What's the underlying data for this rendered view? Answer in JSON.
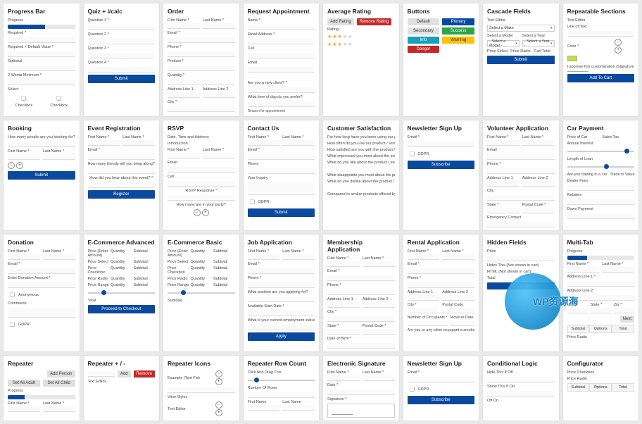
{
  "cards": {
    "progress_bar": {
      "title": "Progress Bar",
      "fields": [
        "Progress",
        "Required *",
        "Required + Default Value *",
        "Optional",
        "2 Words Minimum *",
        "Select"
      ],
      "checkbox_a": "Checkbox",
      "checkbox_b": "Checkbox",
      "progress_pct": 55
    },
    "quiz": {
      "title": "Quiz + #calc",
      "fields": [
        "Question 1 *",
        "Question 2 *",
        "Question 3 *",
        "Question 4 *"
      ],
      "submit": "Submit"
    },
    "order": {
      "title": "Order",
      "first": "First Name *",
      "last": "Last Name *",
      "email": "Email *",
      "phone": "Phone *",
      "product": "Product *",
      "qty": "Quantity *",
      "addr1": "Address Line 1",
      "addr2": "Address Line 2",
      "city": "City *"
    },
    "request_appt": {
      "title": "Request Appointment",
      "name": "Name *",
      "email": "Email Address *",
      "cell": "Cell",
      "email2": "Email",
      "new_client": "Are you a new client? *",
      "time_q": "What time of day do you prefer?",
      "reason": "Reason for appointment"
    },
    "avg_rating": {
      "title": "Average Rating",
      "add": "Add Rating",
      "remove": "Remove Rating",
      "rating_lbl": "Rating",
      "stars": 3
    },
    "buttons": {
      "title": "Buttons",
      "labels": {
        "default": "Default",
        "primary": "Primary",
        "secondary": "Secondary",
        "success": "Success",
        "info": "Info",
        "warning": "Warning",
        "danger": "Danger"
      }
    },
    "cascade": {
      "title": "Cascade Fields",
      "text_editor": "Text Editor",
      "select_make": "Select a Make",
      "select_model": "Select a Model",
      "select_year": "Select a Year",
      "select_model2": "- Select a Model -",
      "select_year2": "- Select a Year -",
      "price_select": "Price Select",
      "price_radio": "Price Radio",
      "cart_total": "Cart Total",
      "submit": "Submit"
    },
    "repeatable": {
      "title": "Repeatable Sections",
      "text_editor": "Text Editor",
      "line_of_text": "Line of Text",
      "color": "Color *",
      "approve": "I approve this customization (Signature) *",
      "add_cart": "Add To Cart"
    },
    "booking": {
      "title": "Booking",
      "q1": "How many people are you booking for?",
      "first": "First Name *",
      "last": "Last Name *",
      "submit": "Submit"
    },
    "event_reg": {
      "title": "Event Registration",
      "first": "First Name *",
      "last": "Last Name *",
      "email": "Email *",
      "friends_q": "How many friends will you bring along? *",
      "heard_q": "How did you hear about this event? *",
      "register": "Register"
    },
    "rsvp": {
      "title": "RSVP",
      "dta": "Date, Time and Address",
      "intro": "Introduction",
      "first": "First Name *",
      "last": "Last Name *",
      "email": "Email",
      "cell": "Cell",
      "response": "RSVP Response *",
      "party_q": "How many are in your party?"
    },
    "contact": {
      "title": "Contact Us",
      "first": "First Name *",
      "last": "Last Name *",
      "email": "Email *",
      "phone": "Phone",
      "inquiry": "Your Inquiry",
      "gdpr": "GDPR",
      "submit": "Submit"
    },
    "cust_sat": {
      "title": "Customer Satisfaction",
      "q1": "For how long have you been using our product / …",
      "q2": "How often do you use our product / service?",
      "q3": "How satisfied are you with the product / service …",
      "q4": "What impressed you most about the product / s…",
      "q5": "What do you like about the product / service?",
      "q6": "What disappoints you most about the product …",
      "q7": "What do you dislike about the product / service?",
      "q8": "Compared to similar products offered by other c…"
    },
    "newsletter": {
      "title": "Newsletter Sign Up",
      "email": "Email *",
      "gdpr": "GDPR",
      "subscribe": "Subscribe"
    },
    "volunteer": {
      "title": "Volunteer Application",
      "first": "First Name *",
      "last": "Last Name *",
      "email": "Email",
      "phone": "Phone *",
      "addr1": "Address Line 1",
      "addr2": "Address Line 2",
      "city": "City",
      "state": "State *",
      "postal": "Postal Code *",
      "emergency": "Emergency Contact"
    },
    "car_payment": {
      "title": "Car Payment",
      "price": "Price of Car",
      "tax": "Sales Tax",
      "interest": "Annual Interest",
      "loan": "Length of Loan",
      "trading_q": "Are you trading in a car",
      "trade_val": "Trade in Value",
      "dealer": "Dealer Fees",
      "rebates": "Rebates",
      "down": "Down Payment"
    },
    "donation": {
      "title": "Donation",
      "first": "First Name *",
      "last": "Last Name *",
      "email": "Email *",
      "amount": "Enter Donation Amount *",
      "anon": "Anonymous",
      "comments": "Comments",
      "gdpr": "GDPR"
    },
    "ecom_adv": {
      "title": "E-Commerce Advanced",
      "hdr": [
        "Price (Enter Amount)",
        "Quantity",
        "Subtotal"
      ],
      "rows": [
        "Price Select",
        "Price Checkbox",
        "Price Radio",
        "Price Range"
      ],
      "total": "Total",
      "checkout": "Proceed to Checkout"
    },
    "ecom_basic": {
      "title": "E-Commerce Basic",
      "hdr": [
        "Price (Enter Amount)",
        "Quantity",
        "Subtotal"
      ],
      "rows": [
        "Price Select",
        "Price Checkbox",
        "Price Radio",
        "Price Range"
      ],
      "subtotal": "Subtotal"
    },
    "job_app": {
      "title": "Job Application",
      "first": "First Name *",
      "last": "Last Name *",
      "email": "Email *",
      "phone": "Phone *",
      "position": "What position are you applying for?",
      "start": "Available Start Date *",
      "status_q": "What is your current employment status?",
      "apply": "Apply"
    },
    "membership": {
      "title": "Membership Application",
      "first": "First Name *",
      "last": "Last Name *",
      "email": "Email *",
      "phone": "Phone *",
      "addr1": "Address Line 1",
      "addr2": "Address Line 2",
      "city": "City *",
      "state": "State *",
      "postal": "Postal Code *",
      "dob": "Date of Birth *"
    },
    "rental": {
      "title": "Rental Application",
      "first": "First Name *",
      "last": "Last Name *",
      "email": "Email *",
      "phone": "Phone *",
      "addr1": "Address Line 1",
      "addr2": "Address Line 2",
      "city": "City *",
      "postal": "Postal Code",
      "occupants": "Number of Occupants *",
      "move": "Move-in Date",
      "smoker_q": "Are you or any other occupant a smoker? *"
    },
    "hidden": {
      "title": "Hidden Fields",
      "price": "Price",
      "hidden_note": "Hides This (Not shown in cart)",
      "html_note": "HTML (Not shown in cart)",
      "total": "Total",
      "add_cart": "Add To Cart"
    },
    "multitab": {
      "title": "Multi-Tab",
      "progress": "Progress",
      "first": "First Name *",
      "last": "Last Name *",
      "addr1": "Address Line 1 *",
      "addr2": "Address Line 2",
      "city": "City *",
      "state": "State *",
      "zip": "Zip *",
      "next": "Next",
      "tabs": [
        "Subtotal",
        "Options",
        "Total"
      ],
      "price_radio": "Price Radio"
    },
    "repeater": {
      "title": "Repeater",
      "add_person": "Add Person",
      "adult": "Set All Adult",
      "child": "Set All Child",
      "progress": "Progress",
      "first": "First Name *",
      "last": "Last Name *"
    },
    "repeater_pm": {
      "title": "Repeater + / -",
      "text_editor": "Text Editor",
      "add": "Add",
      "remove": "Remove"
    },
    "repeater_icons": {
      "title": "Repeater Icons",
      "ex": "Example (Text Field)",
      "view": "View Styles",
      "text_editor": "Text Editor"
    },
    "repeater_row": {
      "title": "Repeater Row Count",
      "drag": "Click And Drag This",
      "rows": "Number Of Rows",
      "first": "First Name",
      "last": "Last Name"
    },
    "esign": {
      "title": "Electronic Signature",
      "first": "First Name *",
      "last": "Last Name *",
      "date": "Date *",
      "signature": "Signature *"
    },
    "newsletter2": {
      "title": "Newsletter Sign Up",
      "email": "Email *",
      "gdpr": "GDPR",
      "subscribe": "Subscribe"
    },
    "cond_logic": {
      "title": "Conditional Logic",
      "hide": "Hide This If Off",
      "show": "Show This If On",
      "off_on": "Off On"
    },
    "configurator": {
      "title": "Configurator",
      "price_cb": "Price Checkbox",
      "price_radio": "Price Radio",
      "tabs": [
        "Subtotal",
        "Options",
        "Total"
      ]
    }
  },
  "watermark": "WP资源海"
}
